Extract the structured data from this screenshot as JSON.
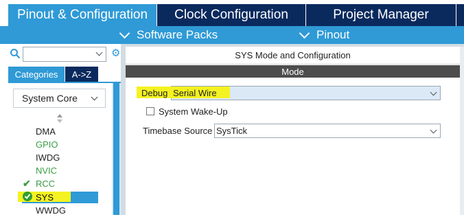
{
  "top_tabs": [
    {
      "label": "Pinout & Configuration",
      "active": true
    },
    {
      "label": "Clock Configuration",
      "active": false
    },
    {
      "label": "Project Manager",
      "active": false
    }
  ],
  "sub_menu": {
    "software_packs": "Software Packs",
    "pinout": "Pinout"
  },
  "left_panel": {
    "search_value": "",
    "tabs": {
      "categories": "Categories",
      "az": "A->Z"
    },
    "category_select": "System Core",
    "items": [
      {
        "label": "DMA",
        "color": "#222222",
        "check": false
      },
      {
        "label": "GPIO",
        "color": "#3a9e45",
        "check": false
      },
      {
        "label": "IWDG",
        "color": "#222222",
        "check": false
      },
      {
        "label": "NVIC",
        "color": "#3a9e45",
        "check": false
      },
      {
        "label": "RCC",
        "color": "#3a9e45",
        "check": true
      },
      {
        "label": "SYS",
        "color": "#ffffff",
        "check": true,
        "selected": true
      },
      {
        "label": "WWDG",
        "color": "#222222",
        "check": false
      }
    ]
  },
  "right_panel": {
    "title": "SYS Mode and Configuration",
    "section": "Mode",
    "debug_label": "Debug",
    "debug_value": "Serial Wire",
    "wakeup_label": "System Wake-Up",
    "wakeup_checked": false,
    "timebase_label": "Timebase Source",
    "timebase_value": "SysTick"
  },
  "colors": {
    "accent": "#2f9ad6",
    "dark_navy": "#0a2a5e",
    "highlight": "#f4f221",
    "green": "#3a9e45"
  }
}
